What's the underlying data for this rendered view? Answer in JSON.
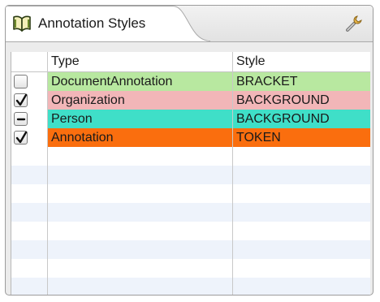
{
  "view": {
    "tab_title": "Annotation Styles",
    "tab_icon": "open-book-icon",
    "toolbar_icon": "wrench-icon"
  },
  "table": {
    "headers": {
      "checked": "",
      "type": "Type",
      "style": "Style"
    },
    "rows": [
      {
        "state": "unchecked",
        "type": "DocumentAnnotation",
        "style": "BRACKET",
        "color": "#b8e8a0"
      },
      {
        "state": "checked",
        "type": "Organization",
        "style": "BACKGROUND",
        "color": "#f2b6b8"
      },
      {
        "state": "mixed",
        "type": "Person",
        "style": "BACKGROUND",
        "color": "#3fdfc8"
      },
      {
        "state": "checked",
        "type": "Annotation",
        "style": "TOKEN",
        "color": "#fa6e0e"
      }
    ]
  }
}
